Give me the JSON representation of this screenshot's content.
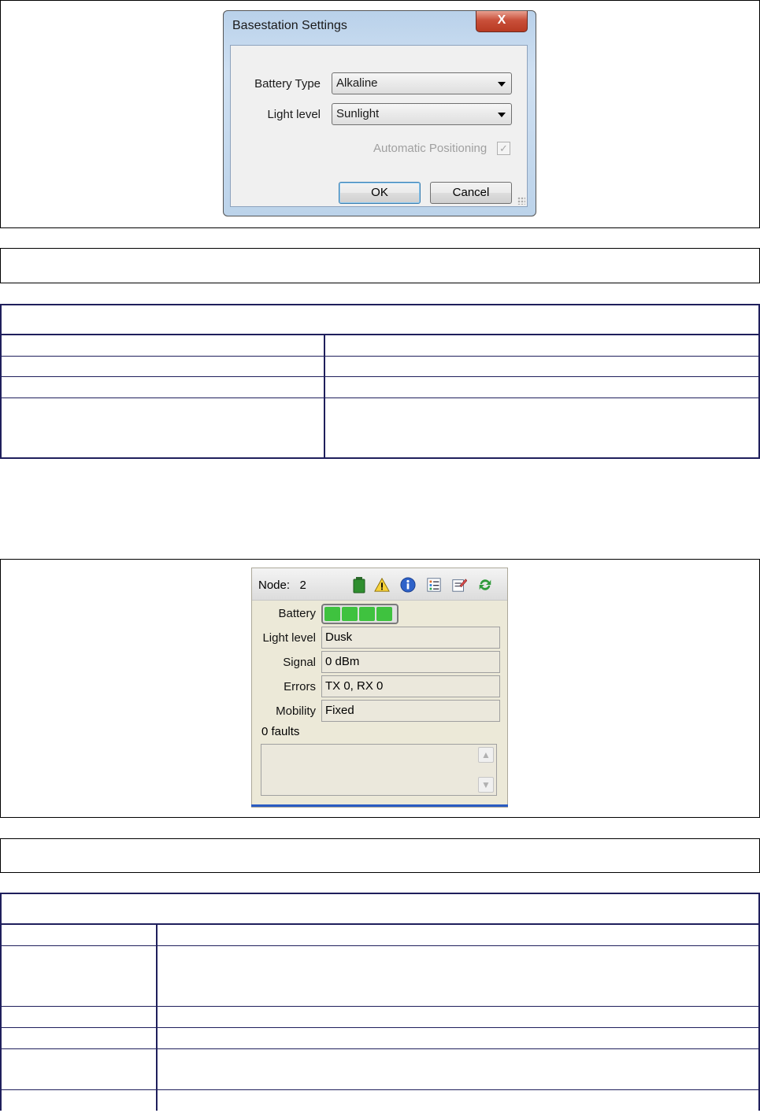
{
  "dialog": {
    "title": "Basestation Settings",
    "close_symbol": "X",
    "battery_type_label": "Battery Type",
    "battery_type_value": "Alkaline",
    "light_level_label": "Light level",
    "light_level_value": "Sunlight",
    "auto_positioning_label": "Automatic Positioning",
    "auto_positioning_check": "✓",
    "ok_label": "OK",
    "cancel_label": "Cancel"
  },
  "node_panel": {
    "node_label": "Node:",
    "node_id": "2",
    "icons": [
      "battery-icon",
      "warning-icon",
      "info-icon",
      "list-icon",
      "edit-icon",
      "refresh-icon"
    ],
    "battery_label": "Battery",
    "battery_level": "4/4",
    "light_level_label": "Light level",
    "light_level_value": "Dusk",
    "signal_label": "Signal",
    "signal_value": "0 dBm",
    "errors_label": "Errors",
    "errors_value": "TX 0, RX 0",
    "mobility_label": "Mobility",
    "mobility_value": "Fixed",
    "faults_label": "0 faults"
  },
  "colors": {
    "battery_cell": "#3fc23f",
    "table_border": "#1f1f5c",
    "close_button": "#c9503a"
  }
}
